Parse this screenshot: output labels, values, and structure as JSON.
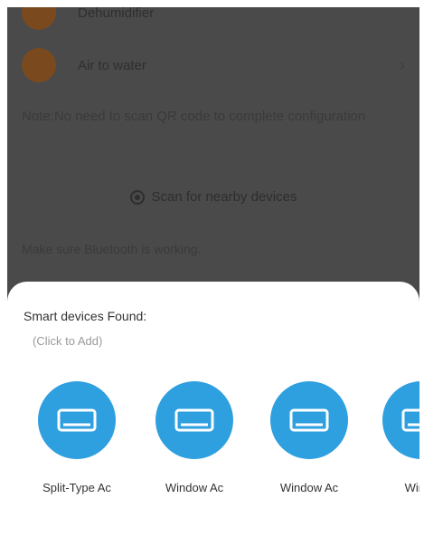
{
  "device_types": [
    {
      "label": "Dehumidifier"
    },
    {
      "label": "Air to water"
    }
  ],
  "note": "Note:No need to scan QR code to complete configuration",
  "scan": {
    "label": "Scan for nearby devices"
  },
  "hint": "Make sure Bluetooth is working.",
  "found_sheet": {
    "title": "Smart devices Found:",
    "subtitle": "(Click to Add)",
    "devices": [
      {
        "label": "Split-Type Ac",
        "icon": "air-conditioner-icon"
      },
      {
        "label": "Window Ac",
        "icon": "air-conditioner-icon"
      },
      {
        "label": "Window Ac",
        "icon": "air-conditioner-icon"
      },
      {
        "label": "Windo",
        "icon": "air-conditioner-icon"
      }
    ]
  },
  "colors": {
    "device_circle": "#2e9fdf",
    "row_icon": "#7a4a1e",
    "dim_overlay": "#4a4a4a"
  }
}
